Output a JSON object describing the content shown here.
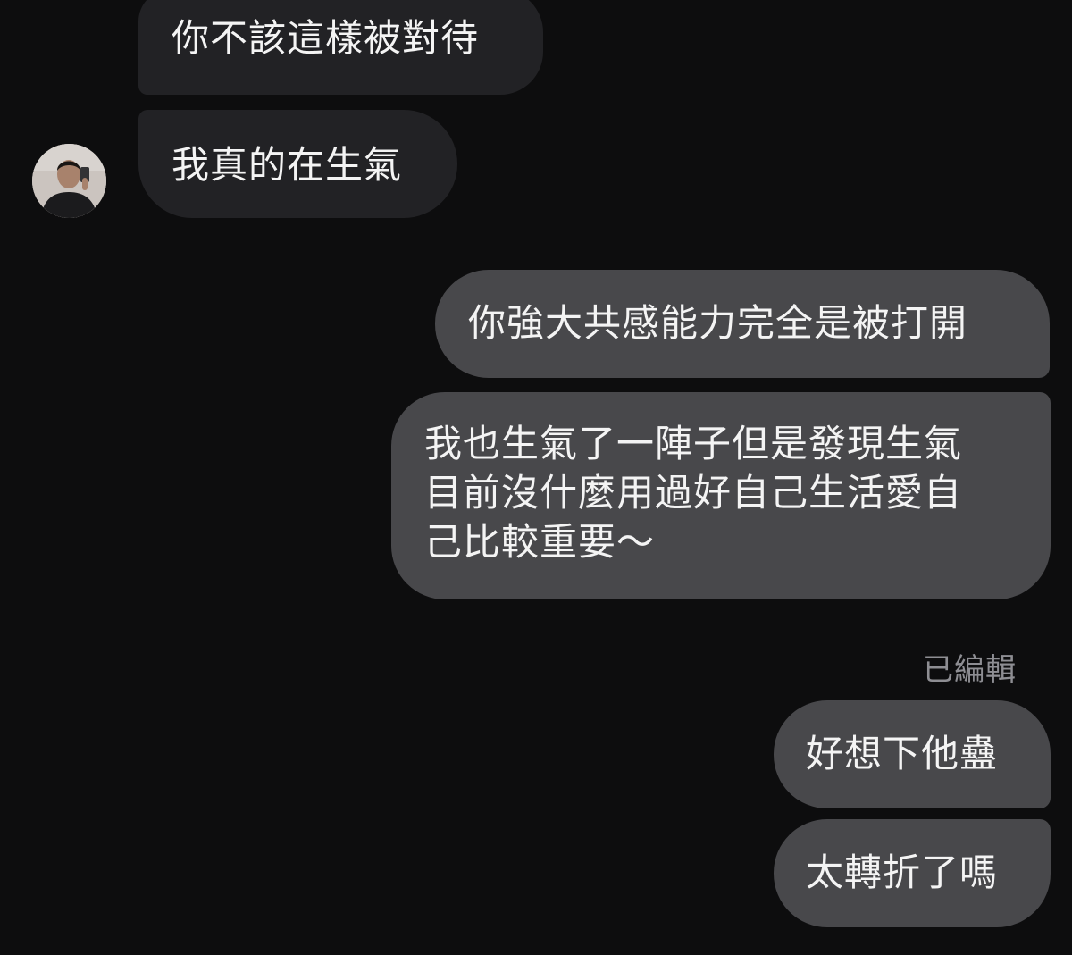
{
  "conversation": {
    "messages": [
      {
        "sender": "contact",
        "text": "你不該這樣被對待"
      },
      {
        "sender": "contact",
        "text": "我真的在生氣"
      },
      {
        "sender": "me",
        "text": "你強大共感能力完全是被打開"
      },
      {
        "sender": "me",
        "lines": [
          "我也生氣了一陣子但是發現生氣",
          "目前沒什麼用過好自己生活愛自",
          "己比較重要～"
        ]
      },
      {
        "sender": "me",
        "status": "已編輯",
        "text": "好想下他蠱"
      },
      {
        "sender": "me",
        "text": "太轉折了嗎"
      }
    ]
  },
  "colors": {
    "background": "#0d0d0e",
    "incoming_bubble": "#222225",
    "outgoing_bubble": "#48484b",
    "edited_label": "#8e8e93"
  },
  "icons": {
    "avatar": "profile-photo"
  }
}
